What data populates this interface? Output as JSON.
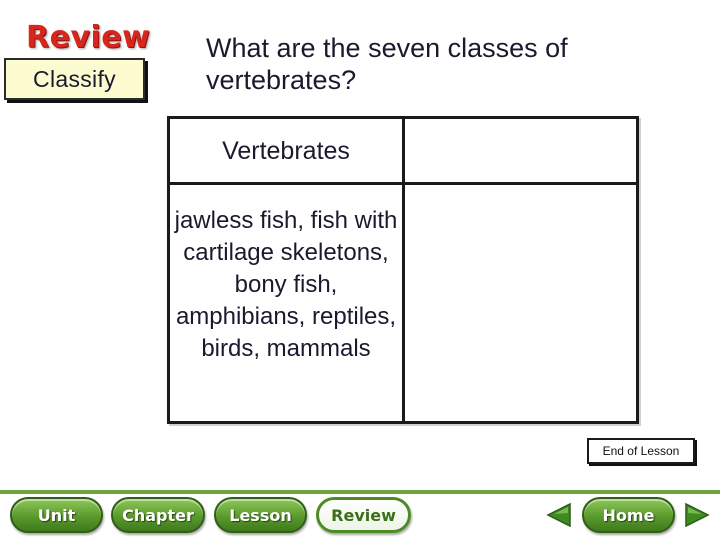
{
  "header": {
    "review_label": "Review",
    "section_label": "Classify",
    "question": "What are the seven classes of vertebrates?"
  },
  "table": {
    "header": "Vertebrates",
    "answer": "jawless fish, fish with cartilage skeletons, bony fish, amphibians, reptiles, birds, mammals"
  },
  "end_lesson_label": "End of Lesson",
  "nav": {
    "unit": "Unit",
    "chapter": "Chapter",
    "lesson": "Lesson",
    "review": "Review",
    "home": "Home",
    "prev_icon": "triangle-left-icon",
    "next_icon": "triangle-right-icon"
  },
  "colors": {
    "review_red": "#d8261c",
    "classify_bg": "#fdfbd0",
    "nav_green": "#5a9a2c",
    "text_navy": "#1a1a2e"
  }
}
